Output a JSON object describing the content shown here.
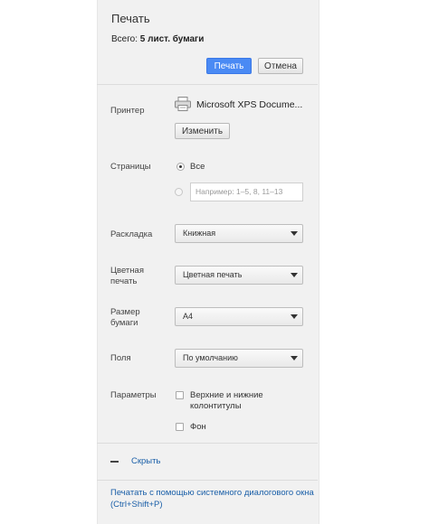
{
  "header": {
    "title": "Печать",
    "total_label": "Всего:",
    "total_value": "5 лист. бумаги"
  },
  "actions": {
    "print_label": "Печать",
    "cancel_label": "Отмена"
  },
  "printer": {
    "label": "Принтер",
    "name": "Microsoft XPS Docume...",
    "change_label": "Изменить"
  },
  "pages": {
    "label": "Страницы",
    "all_label": "Все",
    "selected": "all",
    "range_placeholder": "Например: 1–5, 8, 11–13"
  },
  "layout": {
    "label": "Раскладка",
    "value": "Книжная"
  },
  "color": {
    "label_line1": "Цветная",
    "label_line2": "печать",
    "value": "Цветная печать"
  },
  "paper": {
    "label_line1": "Размер",
    "label_line2": "бумаги",
    "value": "A4"
  },
  "margins": {
    "label": "Поля",
    "value": "По умолчанию"
  },
  "options": {
    "label": "Параметры",
    "headers_line1": "Верхние и нижние",
    "headers_line2": "колонтитулы",
    "headers_checked": false,
    "background": "Фон",
    "background_checked": false
  },
  "toggle": {
    "hide_label": "Скрыть"
  },
  "system_dialog": {
    "line1": "Печатать с помощью системного диалогового окна",
    "line2": "(Ctrl+Shift+P)"
  },
  "colors": {
    "primary": "#4a8af4",
    "link": "#1a5fa8",
    "panel": "#f1f1f1"
  }
}
